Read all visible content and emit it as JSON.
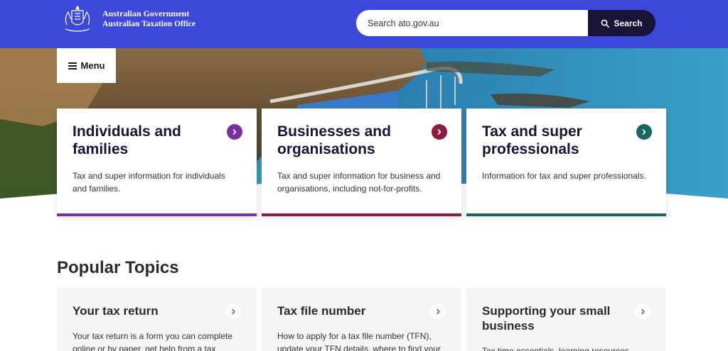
{
  "header": {
    "logo_line1": "Australian Government",
    "logo_line2": "Australian Taxation Office",
    "search_placeholder": "Search ato.gov.au",
    "search_button": "Search",
    "bg_color": "#3b48d9"
  },
  "menu": {
    "label": "Menu"
  },
  "audience_cards": [
    {
      "title": "Individuals and families",
      "description": "Tax and super information for individuals and families.",
      "accent": "#7b2fa0",
      "icon": "chevron-right-icon"
    },
    {
      "title": "Businesses and organisations",
      "description": "Tax and super information for business and organisations, including not-for-profits.",
      "accent": "#8c1c3c",
      "icon": "chevron-right-icon"
    },
    {
      "title": "Tax and super professionals",
      "description": "Information for tax and super professionals.",
      "accent": "#17665f",
      "icon": "chevron-right-icon"
    }
  ],
  "popular": {
    "heading": "Popular Topics",
    "topics": [
      {
        "title": "Your tax return",
        "description": "Your tax return is a form you can complete online or by paper, get help from a tax"
      },
      {
        "title": "Tax file number",
        "description": "How to apply for a tax file number (TFN), update your TFN details, where to find your"
      },
      {
        "title": "Supporting your small business",
        "description": "Tax time essentials, learning resources"
      }
    ]
  }
}
